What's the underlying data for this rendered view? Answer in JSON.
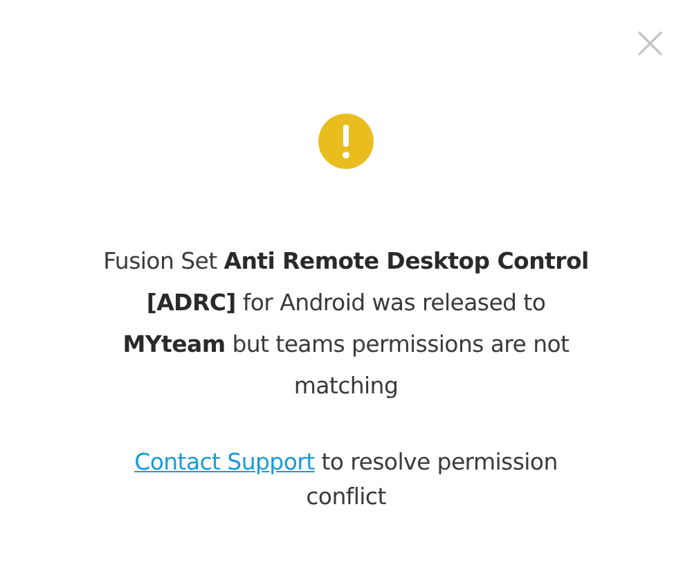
{
  "dialog": {
    "close": "×",
    "message": "Fusion Set **Anti Remote Desktop Control [ADRC]** for Android was released to **MYteam** but teams permissions are not matching",
    "support": {
      "link": "Contact Support",
      "text": "to resolve permission conflict"
    }
  }
}
